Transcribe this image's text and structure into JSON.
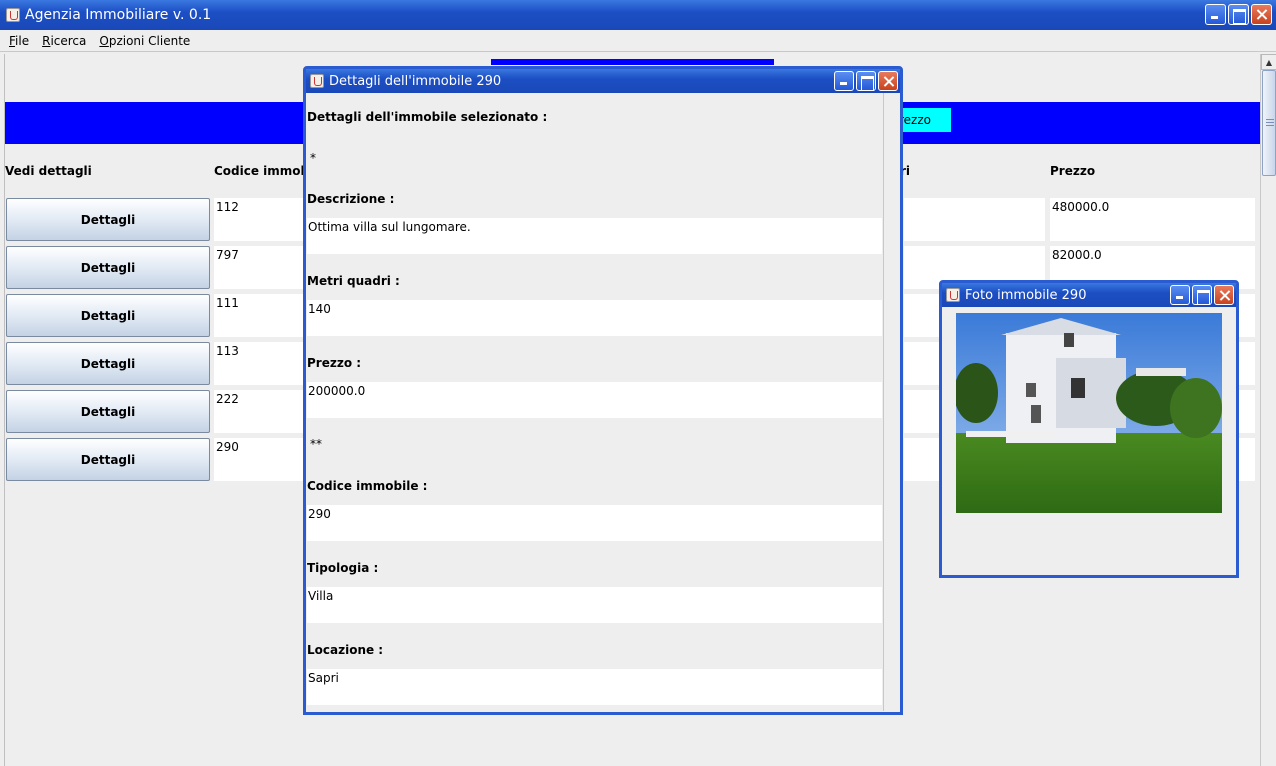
{
  "app": {
    "title": "Agenzia Immobiliare v. 0.1",
    "menus": [
      {
        "mnemonic": "F",
        "rest": "ile"
      },
      {
        "mnemonic": "R",
        "rest": "icerca"
      },
      {
        "mnemonic": "O",
        "rest": "pzioni Cliente"
      }
    ]
  },
  "search_button_label_partial": "rezzo",
  "table": {
    "headers": [
      "Vedi dettagli",
      "Codice immobile",
      "ri",
      "Prezzo"
    ],
    "button_label": "Dettagli",
    "rows": [
      {
        "code": "112",
        "price": "480000.0"
      },
      {
        "code": "797",
        "price": "82000.0"
      },
      {
        "code": "111",
        "price": ""
      },
      {
        "code": "113",
        "price": ""
      },
      {
        "code": "222",
        "price": ""
      },
      {
        "code": "290",
        "price": ""
      }
    ]
  },
  "details_window": {
    "title": "Dettagli dell'immobile 290",
    "heading": "Dettagli dell'immobile selezionato :",
    "sep1": "*",
    "descrizione_label": "Descrizione :",
    "descrizione_value": "Ottima villa sul lungomare.",
    "metri_label": "Metri quadri :",
    "metri_value": "140",
    "prezzo_label": "Prezzo :",
    "prezzo_value": "200000.0",
    "sep2": "**",
    "codice_label": "Codice immobile :",
    "codice_value": "290",
    "tipologia_label": "Tipologia :",
    "tipologia_value": "Villa",
    "locazione_label": "Locazione :",
    "locazione_value": "Sapri"
  },
  "photo_window": {
    "title": "Foto immobile 290"
  },
  "colors": {
    "titlebar": "#1c4fc4",
    "blue_band": "#0000ff",
    "cyan_button": "#00ffff",
    "close_button": "#c8421e"
  },
  "icons": [
    "java-app-icon",
    "minimize-icon",
    "maximize-icon",
    "close-icon",
    "scroll-up-icon",
    "scroll-down-icon"
  ]
}
